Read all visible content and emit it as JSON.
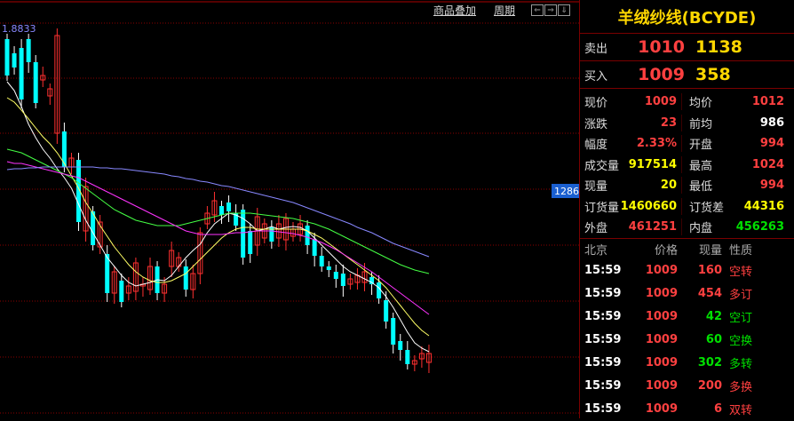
{
  "toolbar": {
    "overlay_label": "商品叠加",
    "period_label": "周期",
    "nav_buttons": [
      "⇐",
      "⇒",
      "⇓"
    ]
  },
  "chart": {
    "top_value_label": "1.8833",
    "right_value_label": "1286",
    "candles": [
      [
        44,
        85
      ],
      [
        60,
        76
      ],
      [
        54,
        112
      ],
      [
        44,
        70
      ],
      [
        70,
        116
      ],
      [
        90,
        85
      ],
      [
        108,
        100
      ],
      [
        150,
        40
      ],
      [
        148,
        188
      ],
      [
        188,
        178
      ],
      [
        180,
        250
      ],
      [
        260,
        210
      ],
      [
        238,
        276
      ],
      [
        278,
        250
      ],
      [
        286,
        330
      ],
      [
        330,
        306
      ],
      [
        316,
        340
      ],
      [
        330,
        322
      ],
      [
        328,
        296
      ],
      [
        322,
        320
      ],
      [
        326,
        300
      ],
      [
        300,
        330
      ],
      [
        330,
        320
      ],
      [
        300,
        282
      ],
      [
        300,
        290
      ],
      [
        300,
        326
      ],
      [
        326,
        308
      ],
      [
        308,
        262
      ],
      [
        252,
        240
      ],
      [
        242,
        226
      ],
      [
        232,
        242
      ],
      [
        228,
        238
      ],
      [
        240,
        254
      ],
      [
        236,
        290
      ],
      [
        260,
        286
      ],
      [
        276,
        244
      ],
      [
        268,
        252
      ],
      [
        256,
        272
      ],
      [
        268,
        252
      ],
      [
        270,
        246
      ],
      [
        266,
        258
      ],
      [
        264,
        252
      ],
      [
        254,
        276
      ],
      [
        270,
        288
      ],
      [
        288,
        300
      ],
      [
        300,
        304
      ],
      [
        306,
        314
      ],
      [
        308,
        322
      ],
      [
        320,
        314
      ],
      [
        318,
        310
      ],
      [
        318,
        306
      ],
      [
        312,
        320
      ],
      [
        318,
        336
      ],
      [
        338,
        362
      ],
      [
        358,
        388
      ],
      [
        384,
        394
      ],
      [
        394,
        410
      ],
      [
        410,
        406
      ],
      [
        404,
        398
      ],
      [
        408,
        398
      ]
    ],
    "ma": [
      {
        "color": "#ffffff",
        "values": [
          92,
          102,
          120,
          140,
          155,
          168,
          178,
          190,
          200,
          212,
          230,
          248,
          262,
          276,
          290,
          300,
          310,
          318,
          322,
          320,
          318,
          315,
          316,
          310,
          300,
          290,
          282,
          275,
          262,
          252,
          246,
          240,
          242,
          246,
          252,
          260,
          258,
          255,
          258,
          256,
          255,
          256,
          260,
          268,
          276,
          284,
          292,
          300,
          306,
          310,
          314,
          318,
          324,
          334,
          346,
          360,
          374,
          386,
          392,
          396
        ]
      },
      {
        "color": "#ffff66",
        "values": [
          110,
          115,
          124,
          134,
          144,
          154,
          162,
          172,
          184,
          198,
          212,
          228,
          240,
          254,
          266,
          278,
          288,
          298,
          306,
          312,
          316,
          318,
          318,
          316,
          312,
          308,
          300,
          292,
          284,
          276,
          268,
          262,
          258,
          256,
          256,
          258,
          258,
          258,
          258,
          258,
          258,
          258,
          260,
          264,
          268,
          274,
          280,
          286,
          292,
          298,
          304,
          310,
          316,
          324,
          334,
          344,
          354,
          364,
          372,
          378
        ]
      },
      {
        "color": "#44ff44",
        "values": [
          168,
          170,
          172,
          176,
          180,
          184,
          188,
          192,
          196,
          200,
          206,
          212,
          218,
          224,
          230,
          236,
          240,
          244,
          248,
          250,
          252,
          254,
          254,
          254,
          254,
          252,
          250,
          248,
          246,
          244,
          242,
          240,
          240,
          240,
          240,
          241,
          242,
          243,
          244,
          245,
          246,
          248,
          250,
          252,
          255,
          258,
          262,
          266,
          270,
          274,
          278,
          282,
          286,
          290,
          294,
          298,
          301,
          304,
          306,
          308
        ]
      },
      {
        "color": "#ff33ff",
        "values": [
          182,
          184,
          184,
          186,
          188,
          190,
          192,
          194,
          196,
          198,
          200,
          204,
          208,
          212,
          216,
          220,
          224,
          228,
          232,
          236,
          240,
          244,
          248,
          252,
          256,
          260,
          262,
          264,
          264,
          264,
          264,
          263,
          262,
          262,
          261,
          260,
          260,
          260,
          261,
          262,
          263,
          265,
          267,
          270,
          273,
          277,
          281,
          286,
          291,
          296,
          301,
          306,
          312,
          318,
          324,
          330,
          336,
          342,
          348,
          354
        ]
      },
      {
        "color": "#8888ff",
        "values": [
          191,
          190,
          190,
          189,
          189,
          188,
          188,
          188,
          188,
          188,
          188,
          188,
          188,
          189,
          189,
          190,
          190,
          191,
          192,
          193,
          194,
          195,
          196,
          198,
          199,
          201,
          202,
          204,
          205,
          207,
          209,
          210,
          212,
          214,
          216,
          218,
          220,
          222,
          224,
          226,
          228,
          231,
          234,
          237,
          240,
          243,
          246,
          249,
          252,
          256,
          259,
          262,
          266,
          270,
          274,
          277,
          280,
          283,
          286,
          289
        ]
      }
    ]
  },
  "panel": {
    "title": "羊绒纱线(BCYDE)",
    "sell": {
      "label": "卖出",
      "price": "1010",
      "volume": "1138"
    },
    "buy": {
      "label": "买入",
      "price": "1009",
      "volume": "358"
    },
    "stats": [
      {
        "left_label": "现价",
        "left_value": "1009",
        "left_color": "red",
        "right_label": "均价",
        "right_value": "1012",
        "right_color": "red"
      },
      {
        "left_label": "涨跌",
        "left_value": "23",
        "left_color": "red",
        "right_label": "前均",
        "right_value": "986",
        "right_color": "white"
      },
      {
        "left_label": "幅度",
        "left_value": "2.33%",
        "left_color": "red",
        "right_label": "开盘",
        "right_value": "994",
        "right_color": "red"
      },
      {
        "left_label": "成交量",
        "left_value": "917514",
        "left_color": "yellow",
        "right_label": "最高",
        "right_value": "1024",
        "right_color": "red"
      },
      {
        "left_label": "现量",
        "left_value": "20",
        "left_color": "yellow",
        "right_label": "最低",
        "right_value": "994",
        "right_color": "red"
      },
      {
        "left_label": "订货量",
        "left_value": "1460660",
        "left_color": "yellow",
        "right_label": "订货差",
        "right_value": "44316",
        "right_color": "yellow"
      },
      {
        "left_label": "外盘",
        "left_value": "461251",
        "left_color": "red",
        "right_label": "内盘",
        "right_value": "456263",
        "right_color": "green"
      }
    ],
    "ticks_header": {
      "time": "北京",
      "price": "价格",
      "volume": "现量",
      "nature": "性质"
    },
    "ticks": [
      {
        "time": "15:59",
        "price": "1009",
        "volume": "160",
        "volume_color": "red",
        "nature": "空转",
        "nature_color": "red"
      },
      {
        "time": "15:59",
        "price": "1009",
        "volume": "454",
        "volume_color": "red",
        "nature": "多订",
        "nature_color": "red"
      },
      {
        "time": "15:59",
        "price": "1009",
        "volume": "42",
        "volume_color": "green",
        "nature": "空订",
        "nature_color": "green"
      },
      {
        "time": "15:59",
        "price": "1009",
        "volume": "60",
        "volume_color": "green",
        "nature": "空换",
        "nature_color": "green"
      },
      {
        "time": "15:59",
        "price": "1009",
        "volume": "302",
        "volume_color": "green",
        "nature": "多转",
        "nature_color": "green"
      },
      {
        "time": "15:59",
        "price": "1009",
        "volume": "200",
        "volume_color": "red",
        "nature": "多换",
        "nature_color": "red"
      },
      {
        "time": "15:59",
        "price": "1009",
        "volume": "6",
        "volume_color": "red",
        "nature": "双转",
        "nature_color": "red"
      }
    ]
  }
}
